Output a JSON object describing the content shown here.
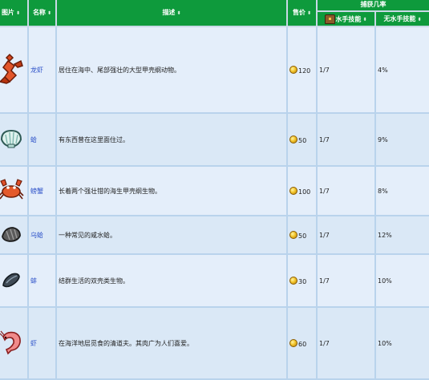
{
  "headers": {
    "image": "图片",
    "name": "名称",
    "description": "描述",
    "price": "售价",
    "catch_chance": "捕获几率",
    "with_skill": "水手技能",
    "without_skill": "无水手技能"
  },
  "rows": [
    {
      "icon": "lobster-icon",
      "name": "龙虾",
      "description": "居住在海中、尾部强壮的大型甲壳纲动物。",
      "price": "120",
      "skill": "1/7",
      "no_skill": "4%"
    },
    {
      "icon": "clam-icon",
      "name": "蛤",
      "description": "有东西曾在这里面住过。",
      "price": "50",
      "skill": "1/7",
      "no_skill": "9%"
    },
    {
      "icon": "crab-icon",
      "name": "螃蟹",
      "description": "长着两个强壮钳的海生甲壳纲生物。",
      "price": "100",
      "skill": "1/7",
      "no_skill": "8%"
    },
    {
      "icon": "cockle-icon",
      "name": "乌蛤",
      "description": "一种常见的咸水蛤。",
      "price": "50",
      "skill": "1/7",
      "no_skill": "12%"
    },
    {
      "icon": "mussel-icon",
      "name": "蚌",
      "description": "结群生活的双壳类生物。",
      "price": "30",
      "skill": "1/7",
      "no_skill": "10%"
    },
    {
      "icon": "shrimp-icon",
      "name": "虾",
      "description": "在海洋地层觅食的清道夫。其肉广为人们喜爱。",
      "price": "60",
      "skill": "1/7",
      "no_skill": "10%"
    }
  ],
  "colors": {
    "header_bg": "#0e9a3c",
    "row_bg": "#e4eefa",
    "row_alt_bg": "#dae8f6",
    "grid": "#b9d3ec",
    "link": "#2b50c8"
  }
}
